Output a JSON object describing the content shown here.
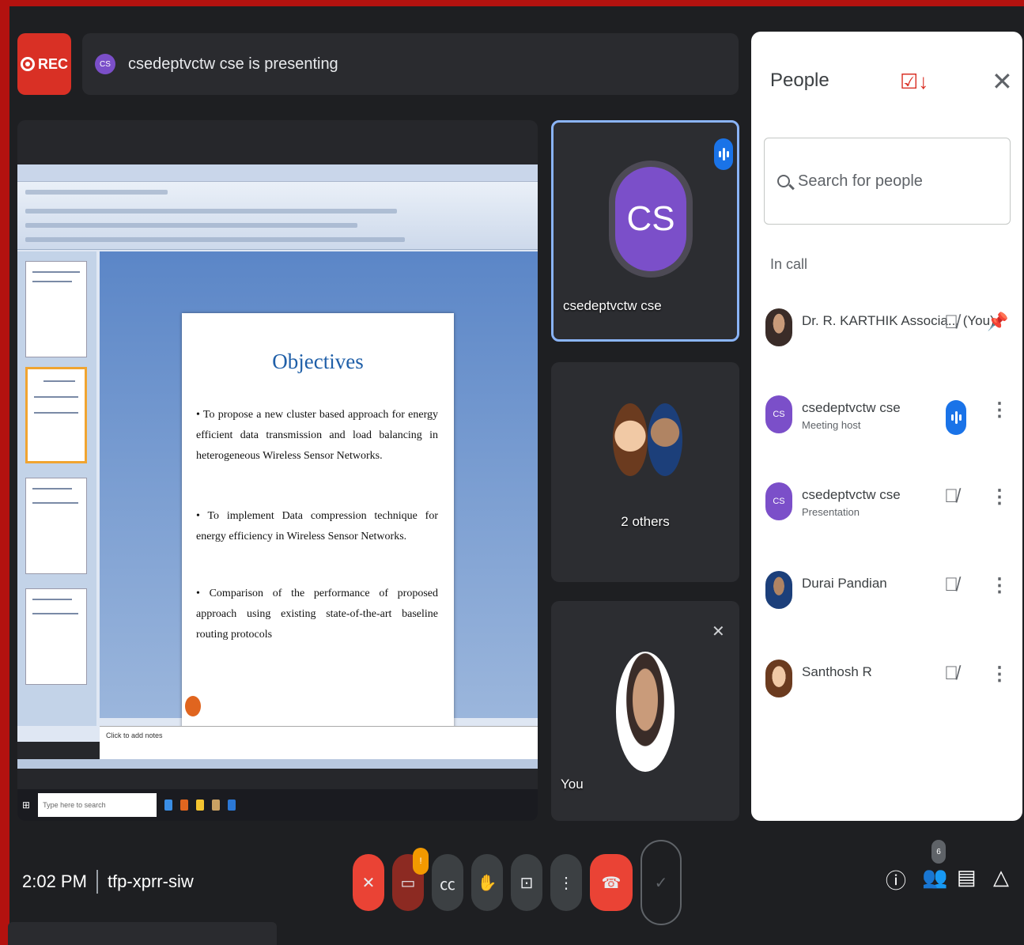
{
  "recording": {
    "label": "REC"
  },
  "presenting": {
    "avatar_initials": "CS",
    "text": "csedeptvctw cse is presenting"
  },
  "slide": {
    "title": "Objectives",
    "bullets": [
      "• To propose a new cluster based approach for energy efficient data transmission and load balancing in heterogeneous Wireless Sensor Networks.",
      "• To implement Data compression technique for energy efficiency in Wireless Sensor Networks.",
      "• Comparison of the performance of proposed approach using existing state-of-the-art baseline routing protocols"
    ],
    "notes_placeholder": "Click to add notes",
    "taskbar_search": "Type here to search"
  },
  "tiles": {
    "presenter": {
      "initials": "CS",
      "name": "csedeptvctw cse"
    },
    "others": {
      "label": "2 others"
    },
    "you": {
      "label": "You"
    }
  },
  "panel": {
    "title": "People",
    "search_placeholder": "Search for people",
    "section_label": "In call",
    "people": [
      {
        "name": "Dr. R. KARTHIK Associa... (You)",
        "role": "",
        "mic": "muted",
        "action": "pin"
      },
      {
        "name": "csedeptvctw cse",
        "role": "Meeting host",
        "mic": "speaking",
        "action": "more",
        "initials": "CS"
      },
      {
        "name": "csedeptvctw cse",
        "role": "Presentation",
        "mic": "muted",
        "action": "more",
        "initials": "CS"
      },
      {
        "name": "Durai Pandian",
        "role": "",
        "mic": "muted",
        "action": "more"
      },
      {
        "name": "Santhosh R",
        "role": "",
        "mic": "muted",
        "action": "more"
      }
    ]
  },
  "bottom": {
    "time": "2:02 PM",
    "meeting_code": "tfp-xprr-siw",
    "people_count": "6",
    "notification_count": "!"
  },
  "colors": {
    "accent_red": "#ea4335",
    "accent_blue": "#1a73e8",
    "avatar_purple": "#7b4fc9",
    "border_red": "#b3120f"
  }
}
